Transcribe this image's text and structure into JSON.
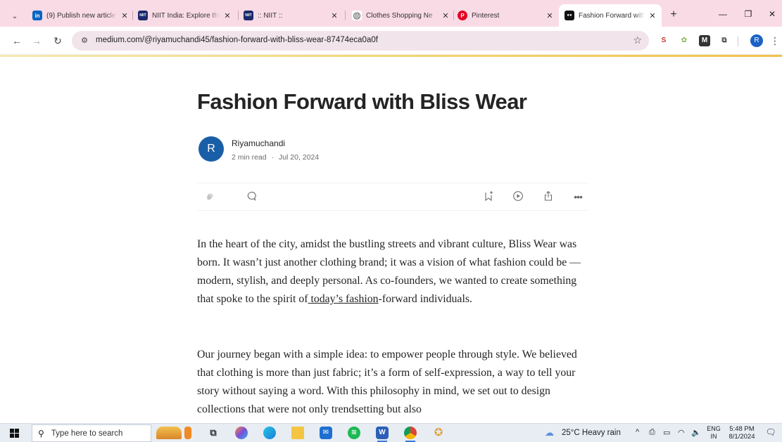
{
  "browser": {
    "tabs": [
      {
        "title": "(9) Publish new article",
        "icon": "linkedin-icon",
        "icon_glyph": "in",
        "icon_color": "#0a66c2"
      },
      {
        "title": "NIIT India: Explore the",
        "icon": "niit-icon",
        "icon_glyph": "NIIT",
        "icon_color": "#1b2a6b"
      },
      {
        "title": ":: NIIT ::",
        "icon": "niit-icon",
        "icon_glyph": "NIIT",
        "icon_color": "#1b2a6b"
      },
      {
        "title": "Clothes Shopping Ne",
        "icon": "globe-icon",
        "icon_glyph": "◍",
        "icon_color": "#555555"
      },
      {
        "title": "Pinterest",
        "icon": "pinterest-icon",
        "icon_glyph": "P",
        "icon_color": "#e60023"
      },
      {
        "title": "Fashion Forward with",
        "icon": "medium-icon",
        "icon_glyph": "●●",
        "icon_color": "#111111"
      }
    ],
    "active_tab_index": 5,
    "url": "medium.com/@riyamuchandi45/fashion-forward-with-bliss-wear-87474eca0a0f",
    "profile_initial": "R",
    "extensions": [
      {
        "name": "s-extension-icon",
        "glyph": "S",
        "color": "#c0392b"
      },
      {
        "name": "leaf-extension-icon",
        "glyph": "✿",
        "color": "#7cb342"
      },
      {
        "name": "m-extension-icon",
        "glyph": "M",
        "color": "#333333"
      },
      {
        "name": "puzzle-extension-icon",
        "glyph": "⧉",
        "color": "#444444"
      }
    ]
  },
  "article": {
    "title": "Fashion Forward with Bliss Wear",
    "author": "Riyamuchandi",
    "avatar_initial": "R",
    "read_time": "2 min read",
    "separator": "·",
    "date": "Jul 20, 2024",
    "paragraphs": [
      {
        "before_link": "In the heart of the city, amidst the bustling streets and vibrant culture, Bliss Wear was born. It wasn’t just another clothing brand; it was a vision of what fashion could be — modern, stylish, and deeply personal. As co-founders, we wanted to create something that spoke to the spirit of",
        "link": " today’s fashion",
        "after_link": "-forward individuals."
      },
      {
        "text": "Our journey began with a simple idea: to empower people through style. We believed that clothing is more than just fabric; it’s a form of self-expression, a way to tell your story without saying a word. With this philosophy in mind, we set out to design collections that were not only trendsetting but also"
      }
    ]
  },
  "taskbar": {
    "search_placeholder": "Type here to search",
    "weather": "25°C  Heavy rain",
    "language_top": "ENG",
    "language_bottom": "IN",
    "time": "5:48 PM",
    "date": "8/1/2024"
  }
}
